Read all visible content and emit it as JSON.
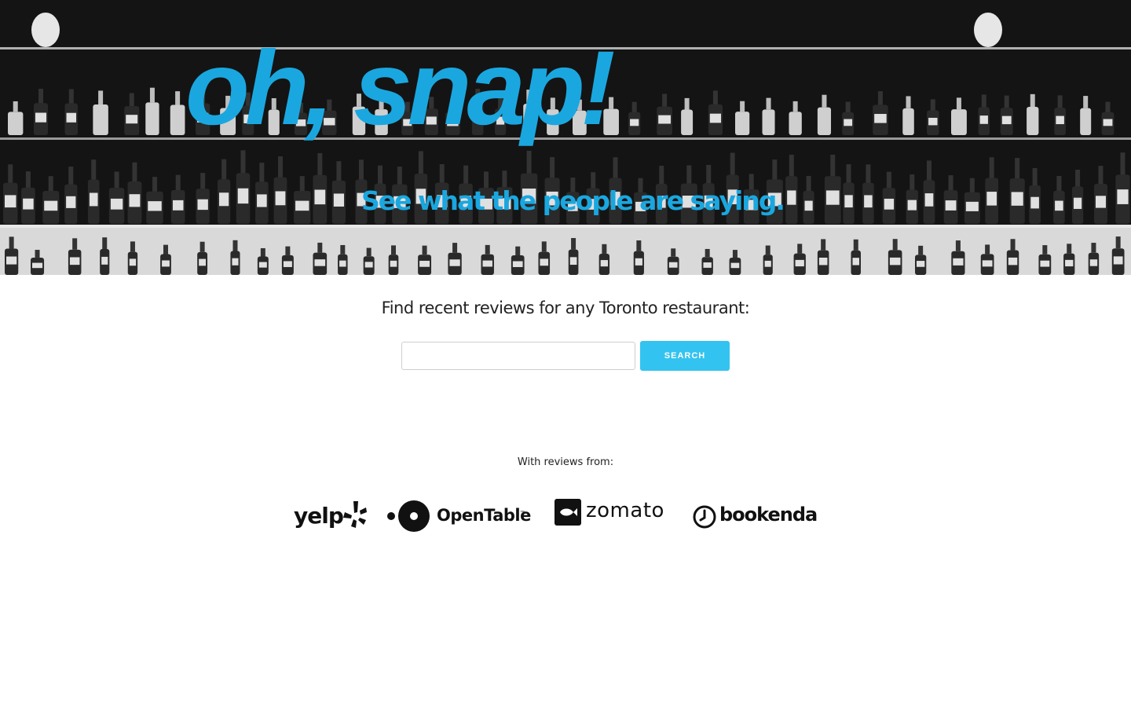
{
  "hero": {
    "title": "oh, snap!",
    "subtitle": "See what the people are saying.",
    "accent_color": "#1aa7e0",
    "background": "black-and-white photo of bar shelves with liquor bottles"
  },
  "search": {
    "prompt": "Find recent reviews for any Toronto restaurant:",
    "input_value": "",
    "placeholder": "",
    "button_label": "SEARCH",
    "button_color": "#33c3f0"
  },
  "sources": {
    "label": "With reviews from:",
    "logos": [
      {
        "name": "yelp",
        "text": "yelp",
        "icon": "yelp-burst-icon"
      },
      {
        "name": "opentable",
        "text": "OpenTable",
        "trademark": "™",
        "icon": "opentable-dots-icon"
      },
      {
        "name": "zomato",
        "text": "zomato",
        "icon": "zomato-fish-icon"
      },
      {
        "name": "bookenda",
        "text": "bookenda",
        "icon": "clock-icon"
      }
    ]
  }
}
